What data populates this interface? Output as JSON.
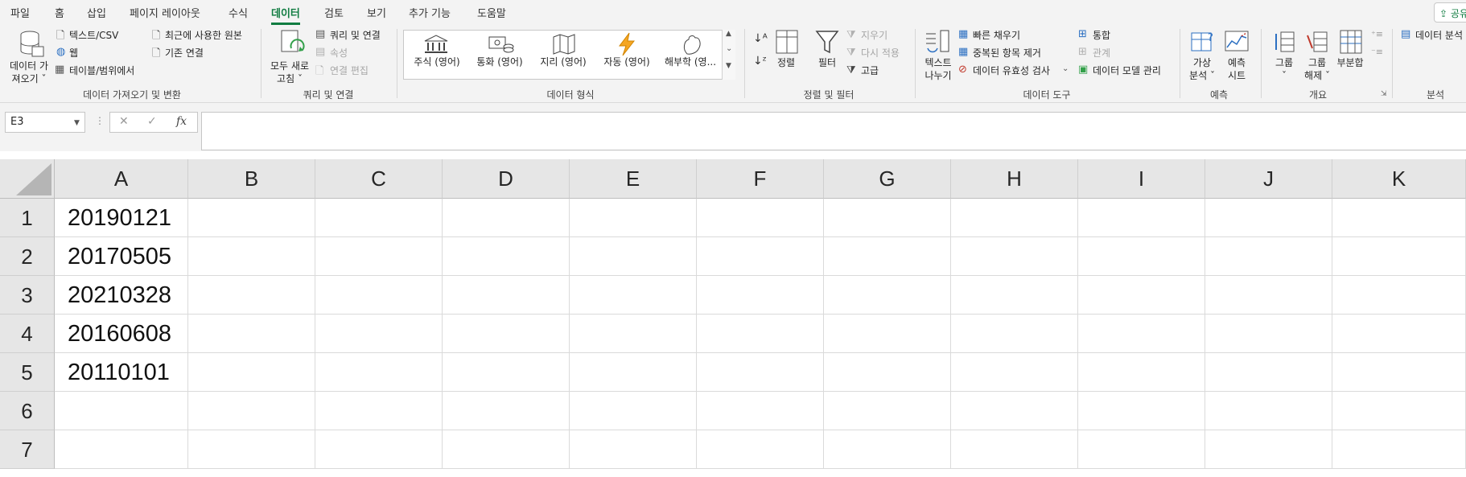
{
  "menu_tabs": [
    {
      "label": "파일"
    },
    {
      "label": "홈"
    },
    {
      "label": "삽입"
    },
    {
      "label": "페이지 레이아웃"
    },
    {
      "label": "수식"
    },
    {
      "label": "데이터"
    },
    {
      "label": "검토"
    },
    {
      "label": "보기"
    },
    {
      "label": "추가 기능"
    },
    {
      "label": "도움말"
    }
  ],
  "active_tab": "데이터",
  "share_label": "공유",
  "ribbon": {
    "get_data": {
      "main_label_1": "데이터 가",
      "main_label_2": "져오기 ˇ",
      "text_csv": "텍스트/CSV",
      "web": "웹",
      "table_range": "테이블/범위에서",
      "recent_sources": "최근에 사용한 원본",
      "existing_conn": "기존 연결",
      "group_label": "데이터 가져오기 및 변환"
    },
    "queries": {
      "refresh_1": "모두 새로",
      "refresh_2": "고침 ˇ",
      "queries_conn": "쿼리 및 연결",
      "properties": "속성",
      "edit_links": "연결 편집",
      "group_label": "쿼리 및 연결"
    },
    "data_types": {
      "items": [
        {
          "label": "주식 (영어)"
        },
        {
          "label": "통화 (영어)"
        },
        {
          "label": "지리 (영어)"
        },
        {
          "label": "자동 (영어)"
        },
        {
          "label": "해부학 (영..."
        }
      ],
      "group_label": "데이터 형식"
    },
    "sort_filter": {
      "sort": "정렬",
      "filter": "필터",
      "clear": "지우기",
      "reapply": "다시 적용",
      "advanced": "고급",
      "group_label": "정렬 및 필터"
    },
    "data_tools": {
      "text_to_cols_1": "텍스트",
      "text_to_cols_2": "나누기",
      "flash_fill": "빠른 채우기",
      "remove_dup": "중복된 항목 제거",
      "validation": "데이터 유효성 검사",
      "consolidate": "통합",
      "relations": "관계",
      "data_model": "데이터 모델 관리",
      "group_label": "데이터 도구"
    },
    "forecast": {
      "what_if_1": "가상",
      "what_if_2": "분석 ˇ",
      "forecast_1": "예측",
      "forecast_2": "시트",
      "group_label": "예측"
    },
    "outline": {
      "group_1": "그룹",
      "group_2": "ˇ",
      "ungroup_1": "그룹",
      "ungroup_2": "해제 ˇ",
      "subtotal": "부분합",
      "group_label": "개요"
    },
    "analysis": {
      "data_analysis": "데이터 분석",
      "group_label": "분석"
    }
  },
  "formula_bar": {
    "name_box": "E3",
    "formula": ""
  },
  "grid": {
    "columns": [
      "A",
      "B",
      "C",
      "D",
      "E",
      "F",
      "G",
      "H",
      "I",
      "J",
      "K"
    ],
    "rows": [
      "1",
      "2",
      "3",
      "4",
      "5",
      "6",
      "7"
    ],
    "cells_A": [
      "20190121",
      "20170505",
      "20210328",
      "20160608",
      "20110101",
      "",
      ""
    ]
  }
}
